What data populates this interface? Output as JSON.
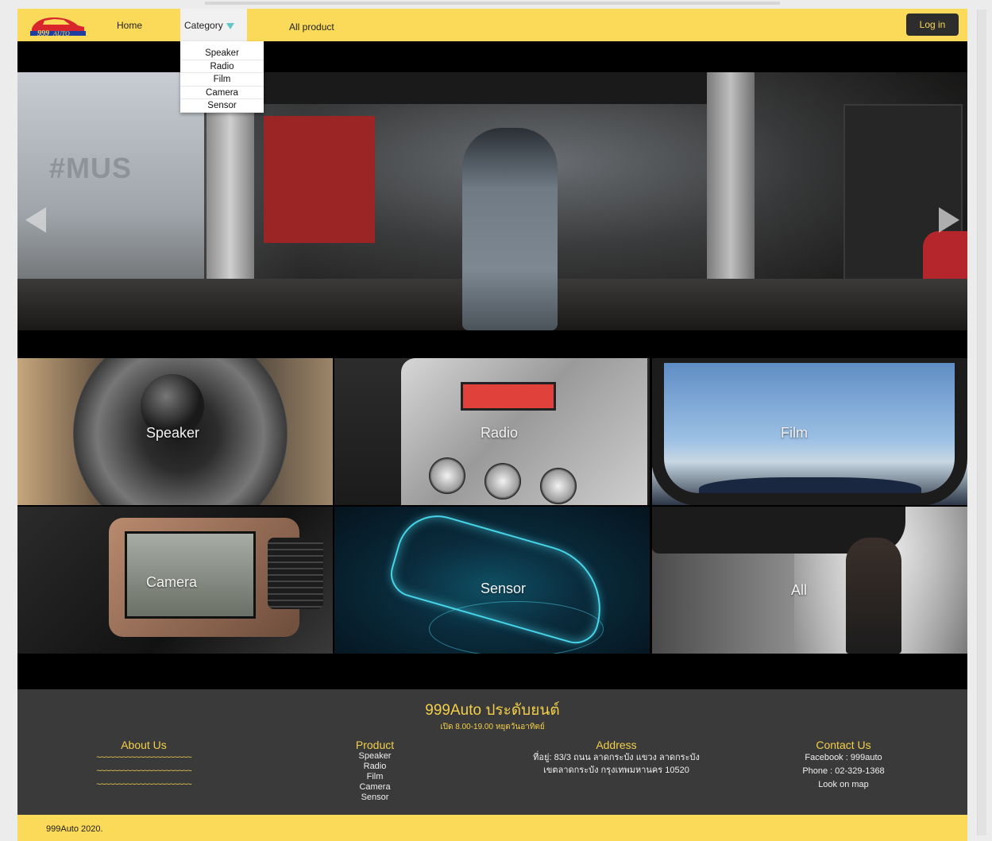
{
  "brand": {
    "logo_text": "999AUTO",
    "colors": {
      "yellow": "#fbd959",
      "dark": "#3a3a3a",
      "accent_teal": "#62c6c8",
      "logo_red": "#d9262c"
    }
  },
  "nav": {
    "home": "Home",
    "category": "Category",
    "all_product": "All product",
    "login": "Log in",
    "caret_icon": "caret-down-icon"
  },
  "dropdown": {
    "items": [
      "Speaker",
      "Radio",
      "Film",
      "Camera",
      "Sensor"
    ]
  },
  "hero": {
    "wall_text": "#MUS",
    "prev_icon": "arrow-left-icon",
    "next_icon": "arrow-right-icon"
  },
  "categories": {
    "tiles": [
      {
        "label": "Speaker"
      },
      {
        "label": "Radio"
      },
      {
        "label": "Film"
      },
      {
        "label": "Camera"
      },
      {
        "label": "Sensor"
      },
      {
        "label": "All"
      }
    ]
  },
  "footer": {
    "brand": "999Auto ประดับยนต์",
    "hours": "เปิด 8.00-19.00 หยุดวันอาทิตย์",
    "about": {
      "heading": "About Us",
      "lines": [
        "~~~~~~~~~~~~~~~~~~~~~~",
        "~~~~~~~~~~~~~~~~~~~~~~",
        "~~~~~~~~~~~~~~~~~~~~~~"
      ]
    },
    "product": {
      "heading": "Product",
      "items": [
        "Speaker",
        "Radio",
        "Film",
        "Camera",
        "Sensor"
      ]
    },
    "address": {
      "heading": "Address",
      "lines": [
        "ที่อยู่: 83/3 ถนน ลาดกระบัง แขวง ลาดกระบัง",
        "เขตลาดกระบัง กรุงเทพมหานคร 10520"
      ]
    },
    "contact": {
      "heading": "Contact Us",
      "facebook": "Facebook : 999auto",
      "phone": "Phone : 02-329-1368",
      "map": "Look on map"
    }
  },
  "copyright": "999Auto 2020."
}
